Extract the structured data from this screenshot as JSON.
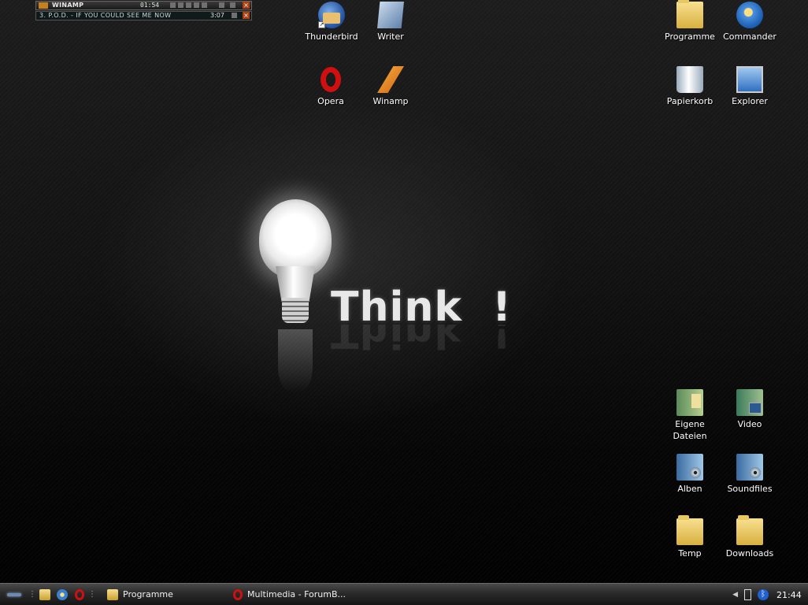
{
  "winamp": {
    "title": "WINAMP",
    "elapsed": "01:54",
    "close": "×",
    "track": "3. P.O.D. - IF YOU COULD SEE ME NOW",
    "duration": "3:07"
  },
  "desktop_icons": {
    "thunderbird": "Thunderbird",
    "writer": "Writer",
    "opera": "Opera",
    "winamp": "Winamp",
    "programme": "Programme",
    "commander": "Commander",
    "papierkorb": "Papierkorb",
    "explorer": "Explorer",
    "eigene_dateien": "Eigene Dateien",
    "video": "Video",
    "alben": "Alben",
    "soundfiles": "Soundfiles",
    "temp": "Temp",
    "downloads": "Downloads"
  },
  "wallpaper": {
    "text": "Think  !"
  },
  "taskbar": {
    "tasks": [
      "Programme",
      "Multimedia - ForumB..."
    ],
    "clock": "21:44",
    "grip": "⋮"
  },
  "icons": {
    "thunderbird": "thunderbird-icon",
    "writer": "writer-icon",
    "opera": "opera-icon",
    "winamp": "winamp-icon",
    "folder": "folder-icon",
    "commander": "commander-icon",
    "trash": "recycle-bin-icon",
    "explorer": "explorer-icon",
    "bluetooth": "bluetooth-icon"
  }
}
